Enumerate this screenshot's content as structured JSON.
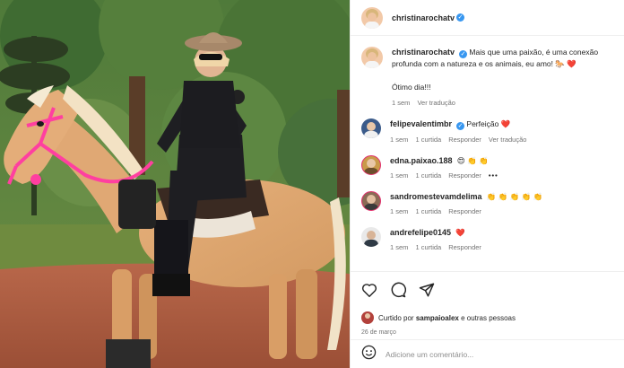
{
  "post": {
    "author": "christinarochatv",
    "caption": "Mais que uma paixão, é uma conexão profunda com a natureza e os animais, eu amo! 🐎 ❤️",
    "greeting": "Ótimo dia!!!",
    "caption_time": "1 sem",
    "caption_translate": "Ver tradução"
  },
  "comments": [
    {
      "user": "felipevalentimbr",
      "verified": true,
      "text": "Perfeição ❤️",
      "time": "1 sem",
      "likes": "1 curtida",
      "reply": "Responder",
      "translate": "Ver tradução",
      "avatar_color": "#3b5b8a"
    },
    {
      "user": "edna.paixao.188",
      "verified": false,
      "text": "😍 👏 👏",
      "time": "1 sem",
      "likes": "1 curtida",
      "reply": "Responder",
      "more": "•••",
      "avatar_color": "#c99a4a"
    },
    {
      "user": "sandromestevamdelima",
      "verified": false,
      "text": "👏 👏 👏 👏 👏",
      "time": "1 sem",
      "likes": "1 curtida",
      "reply": "Responder",
      "avatar_color": "#8a6a55"
    },
    {
      "user": "andrefelipe0145",
      "verified": false,
      "text": "❤️",
      "time": "1 sem",
      "likes": "1 curtida",
      "reply": "Responder",
      "avatar_color": "#2f3a45"
    }
  ],
  "likes_line": {
    "prefix": "Curtido por",
    "user": "sampaioalex",
    "suffix": "e outras pessoas"
  },
  "date": "26 de março",
  "add_comment": {
    "placeholder": "Adicione um comentário..."
  },
  "icons": [
    "heart-icon",
    "comment-icon",
    "share-icon",
    "emoji-icon",
    "verified-icon"
  ],
  "colors": {
    "verified": "#3897f0",
    "heart": "#ed4956",
    "secondary_text": "#737373",
    "bridle": "#ff3fa0"
  }
}
